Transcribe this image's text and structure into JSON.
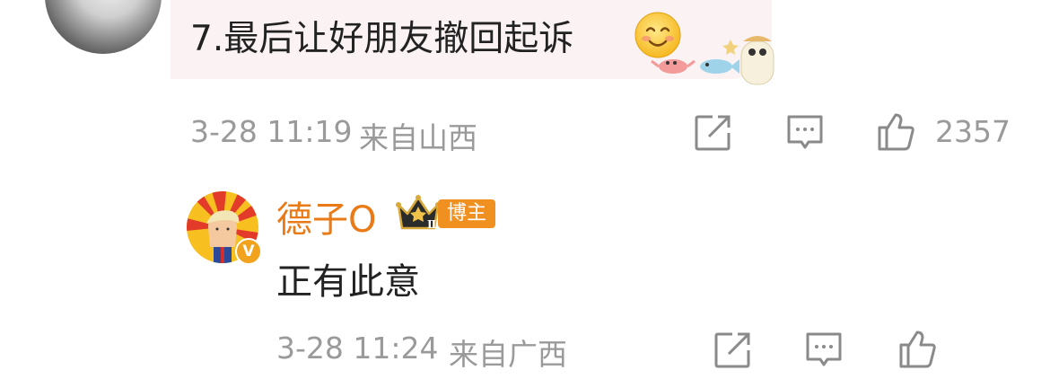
{
  "comment": {
    "text": "7.最后让好朋友撤回起诉",
    "date": "3-28 11:19",
    "location": "来自山西",
    "like_count": "2357"
  },
  "reply": {
    "username": "德子O",
    "role_badge": "博主",
    "verified_mark": "V",
    "crown_level": "Ⅱ",
    "text": "正有此意",
    "date": "3-28 11:24",
    "location": "来自广西"
  },
  "icons": {
    "share": "share-icon",
    "comment": "comment-icon",
    "like": "thumbs-up-icon"
  },
  "colors": {
    "username": "#ea7a16",
    "badge": "#f09020",
    "meta": "#9a9a9a"
  }
}
